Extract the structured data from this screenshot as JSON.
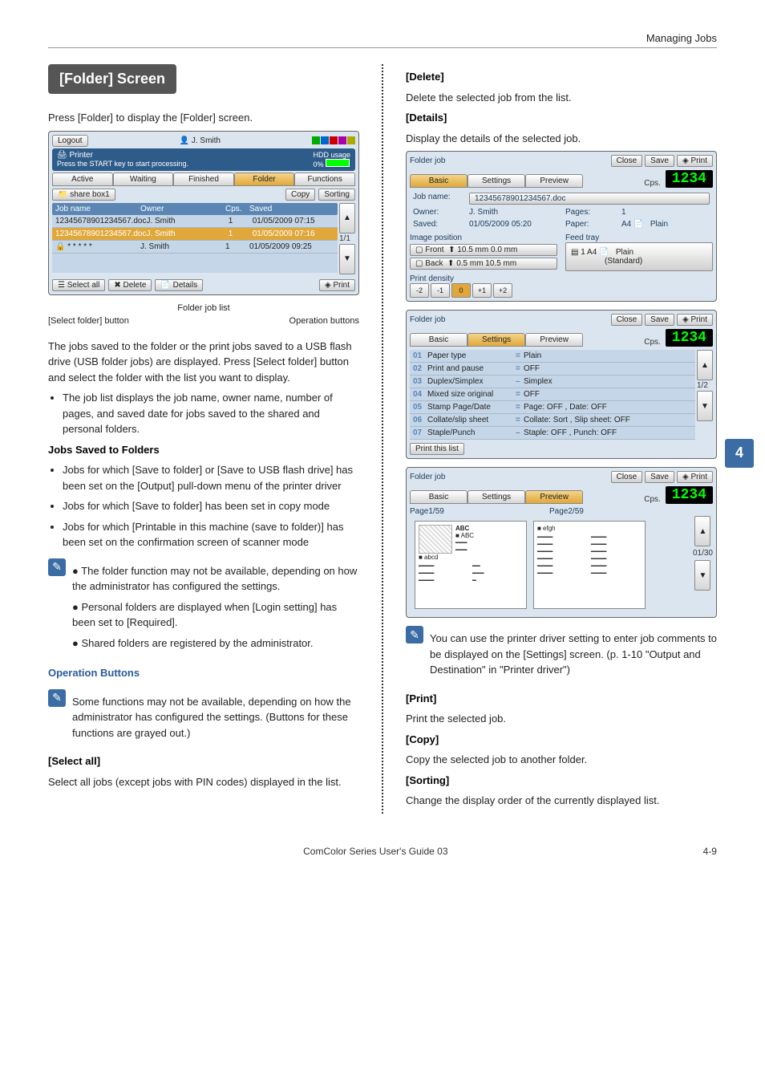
{
  "header": "Managing Jobs",
  "section_title": "[Folder] Screen",
  "intro": "Press [Folder] to display the [Folder] screen.",
  "main_para": "The jobs saved to the folder or the print jobs saved to a USB flash drive (USB folder jobs) are displayed. Press [Select folder] button and select the folder with the list you want to display.",
  "list1": "The job list displays the job name, owner name, number of pages, and saved date for jobs saved to the shared and personal folders.",
  "jobs_saved_heading": "Jobs Saved to Folders",
  "jobs_saved": [
    "Jobs for which [Save to folder] or [Save to USB flash drive] has been set on the [Output] pull-down menu of the printer driver",
    "Jobs for which [Save to folder] has been set in copy mode",
    "Jobs for which [Printable in this machine (save to folder)] has been set on the confirmation screen of scanner mode"
  ],
  "note1": [
    "The folder function may not be available, depending on how the administrator has configured the settings.",
    "Personal folders are displayed when [Login setting] has been set to [Required].",
    "Shared folders are registered by the administrator."
  ],
  "op_heading": "Operation Buttons",
  "op_note": "Some functions may not be available, depending on how the administrator has configured the settings. (Buttons for these functions are grayed out.)",
  "select_all_h": "[Select all]",
  "select_all_b": "Select all jobs (except jobs with PIN codes) displayed in the list.",
  "delete_h": "[Delete]",
  "delete_b": "Delete the selected job from the list.",
  "details_h": "[Details]",
  "details_b": "Display the details of the selected job.",
  "print_h": "[Print]",
  "print_b": "Print the selected job.",
  "copy_h": "[Copy]",
  "copy_b": "Copy the selected job to another folder.",
  "sort_h": "[Sorting]",
  "sort_b": "Change the display order of the currently displayed list.",
  "note2": "You can use the printer driver setting to enter job comments to be displayed on the [Settings] screen. (p. 1-10 \"Output and Destination\" in \"Printer driver\")",
  "ann": {
    "list": "Folder job list",
    "select": "[Select folder] button",
    "ops": "Operation buttons"
  },
  "screen1": {
    "logout": "Logout",
    "user": "J. Smith",
    "printer": "Printer",
    "start": "Press the START key to start processing.",
    "hdd": "HDD usage",
    "hdd_pct": "0%",
    "tabs": [
      "Active",
      "Waiting",
      "Finished",
      "Folder",
      "Functions"
    ],
    "folder": "share box1",
    "copy": "Copy",
    "sorting": "Sorting",
    "cols": [
      "Job name",
      "Owner",
      "Cps.",
      "Saved"
    ],
    "rows": [
      [
        "12345678901234567.doc",
        "J. Smith",
        "1",
        "01/05/2009 07:15"
      ],
      [
        "12345678901234567.doc",
        "J. Smith",
        "1",
        "01/05/2009 07:16"
      ],
      [
        "* * * * *",
        "J. Smith",
        "1",
        "01/05/2009 09:25"
      ]
    ],
    "pager": "1/1",
    "buttons": [
      "Select all",
      "Delete",
      "Details",
      "Print"
    ]
  },
  "screen2": {
    "title": "Folder job",
    "close": "Close",
    "save": "Save",
    "print": "Print",
    "cps_label": "Cps.",
    "cps": "1234",
    "tabs": [
      "Basic",
      "Settings",
      "Preview"
    ],
    "jobname_l": "Job name:",
    "jobname": "12345678901234567.doc",
    "owner_l": "Owner:",
    "owner": "J. Smith",
    "pages_l": "Pages:",
    "pages": "1",
    "saved_l": "Saved:",
    "saved": "01/05/2009 05:20",
    "paper_l": "Paper:",
    "paper": "A4",
    "plain": "Plain",
    "imgpos": "Image position",
    "feed": "Feed tray",
    "front": "Front",
    "front_v": "10.5 mm    0.0 mm",
    "back": "Back",
    "back_v": "0.5 mm    10.5 mm",
    "tray1": "1  A4",
    "tray2": "Plain",
    "tray3": "(Standard)",
    "density": "Print density",
    "ticks": [
      "-2",
      "-1",
      "0",
      "+1",
      "+2"
    ]
  },
  "screen3": {
    "title": "Folder job",
    "close": "Close",
    "save": "Save",
    "print": "Print",
    "cps_label": "Cps.",
    "cps": "1234",
    "tabs": [
      "Basic",
      "Settings",
      "Preview"
    ],
    "rows": [
      [
        "01",
        "Paper type",
        "Plain"
      ],
      [
        "02",
        "Print and pause",
        "OFF"
      ],
      [
        "03",
        "Duplex/Simplex",
        "Simplex"
      ],
      [
        "04",
        "Mixed size original",
        "OFF"
      ],
      [
        "05",
        "Stamp Page/Date",
        "Page: OFF , Date: OFF"
      ],
      [
        "06",
        "Collate/slip sheet",
        "Collate: Sort , Slip sheet: OFF"
      ],
      [
        "07",
        "Staple/Punch",
        "Staple: OFF , Punch: OFF"
      ]
    ],
    "pager": "1/2",
    "btn": "Print this list"
  },
  "screen4": {
    "title": "Folder job",
    "close": "Close",
    "save": "Save",
    "print": "Print",
    "cps_label": "Cps.",
    "cps": "1234",
    "tabs": [
      "Basic",
      "Settings",
      "Preview"
    ],
    "p1": "Page1/59",
    "p2": "Page2/59",
    "t1a": "ABC",
    "t1b": "■ ABC",
    "t1c": "■ abcd",
    "t2": "■ efgh",
    "pager": "01/30"
  },
  "sidetab": "4",
  "pagenum": "4-9",
  "footer": "ComColor Series User's Guide 03"
}
